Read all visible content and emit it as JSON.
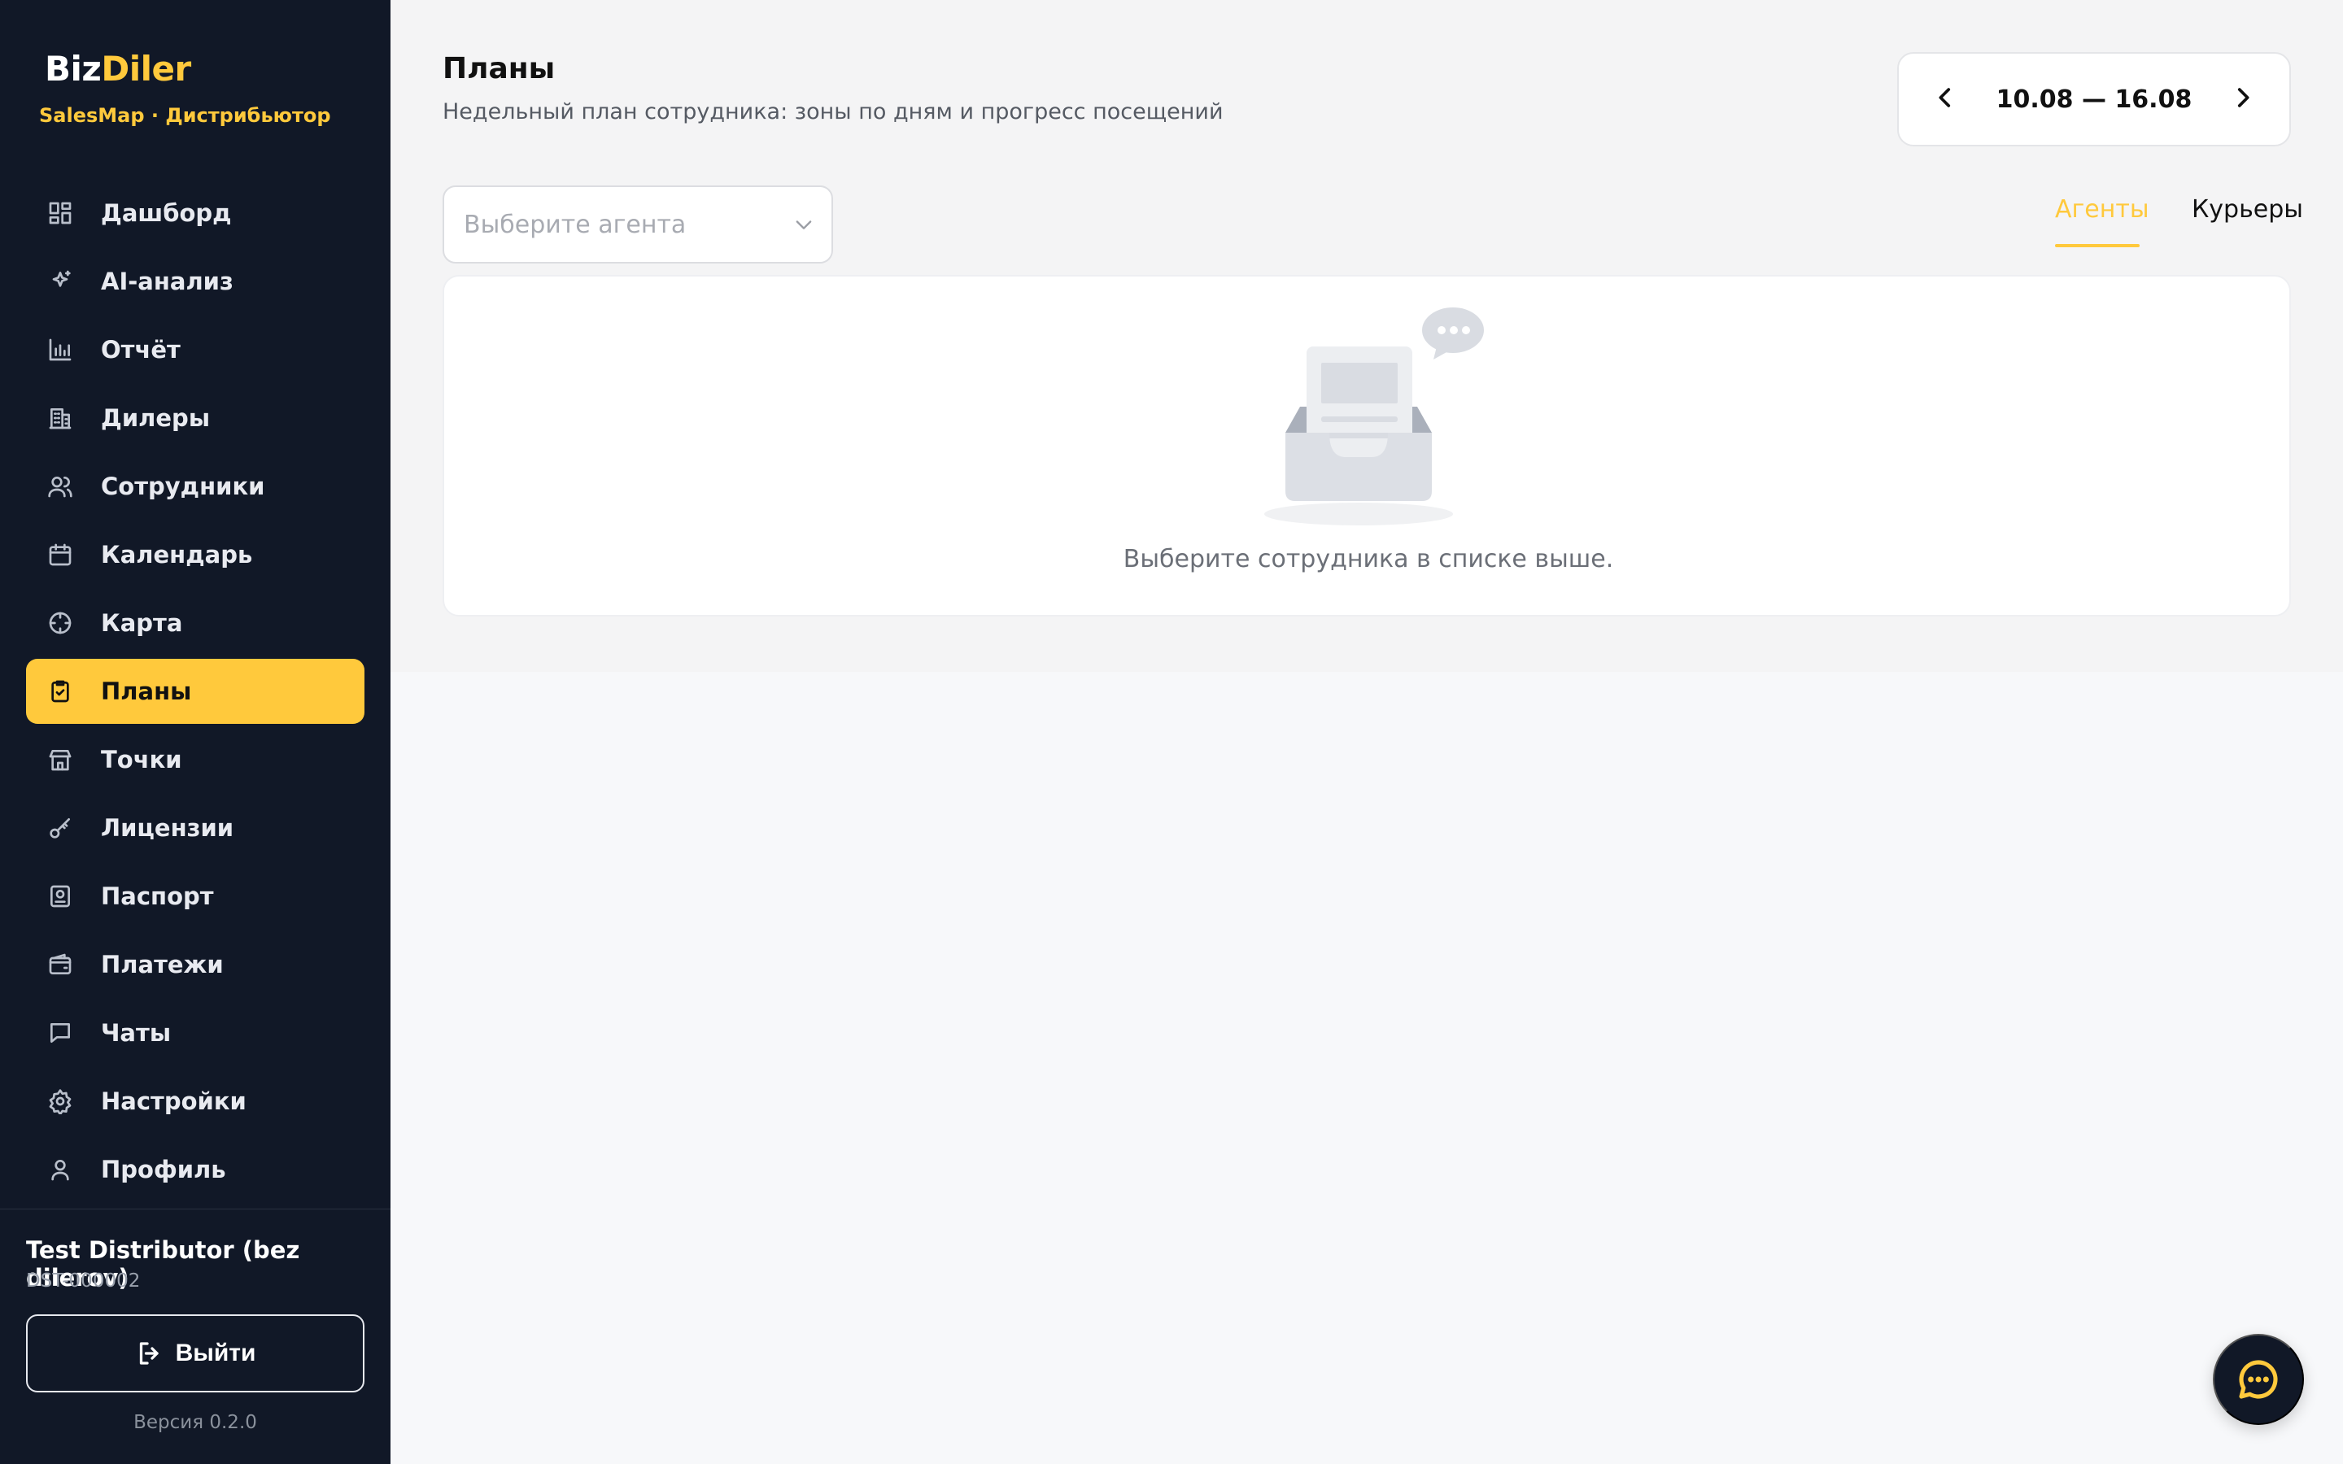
{
  "brand": {
    "part1": "Biz",
    "part2": "Diler",
    "subtitle": "SalesMap · Дистрибьютор"
  },
  "sidebar": {
    "items": [
      {
        "label": "Дашборд",
        "icon": "dashboard-icon"
      },
      {
        "label": "AI-анализ",
        "icon": "sparkle-icon"
      },
      {
        "label": "Отчёт",
        "icon": "bar-chart-icon"
      },
      {
        "label": "Дилеры",
        "icon": "building-icon"
      },
      {
        "label": "Сотрудники",
        "icon": "users-icon"
      },
      {
        "label": "Календарь",
        "icon": "calendar-icon"
      },
      {
        "label": "Карта",
        "icon": "crosshair-icon"
      },
      {
        "label": "Планы",
        "icon": "clipboard-check-icon",
        "active": true
      },
      {
        "label": "Точки",
        "icon": "store-icon"
      },
      {
        "label": "Лицензии",
        "icon": "key-icon"
      },
      {
        "label": "Паспорт",
        "icon": "id-card-icon"
      },
      {
        "label": "Платежи",
        "icon": "wallet-icon"
      },
      {
        "label": "Чаты",
        "icon": "chat-icon"
      },
      {
        "label": "Настройки",
        "icon": "gear-icon"
      },
      {
        "label": "Профиль",
        "icon": "user-icon"
      }
    ]
  },
  "account": {
    "name": "Test Distributor (bez dilerov)",
    "id": "DST-000002"
  },
  "logout": {
    "label": "Выйти",
    "icon": "logout-icon"
  },
  "version": "Версия 0.2.0",
  "header": {
    "title": "Планы",
    "subtitle": "Недельный план сотрудника: зоны по дням и прогресс посещений"
  },
  "week": {
    "range": "10.08 — 16.08",
    "prev_icon": "chevron-left-icon",
    "next_icon": "chevron-right-icon"
  },
  "agent_select": {
    "placeholder": "Выберите агента"
  },
  "tabs": [
    {
      "label": "Агенты",
      "active": true
    },
    {
      "label": "Курьеры",
      "active": false
    }
  ],
  "empty_state": {
    "text": "Выберите сотрудника в списке выше.",
    "icon": "empty-inbox-icon"
  },
  "chat_fab": {
    "icon": "chat-bubble-icon"
  },
  "colors": {
    "accent": "#ffc93c",
    "sidebar_bg": "#111827",
    "page_bg": "#f4f4f5"
  }
}
